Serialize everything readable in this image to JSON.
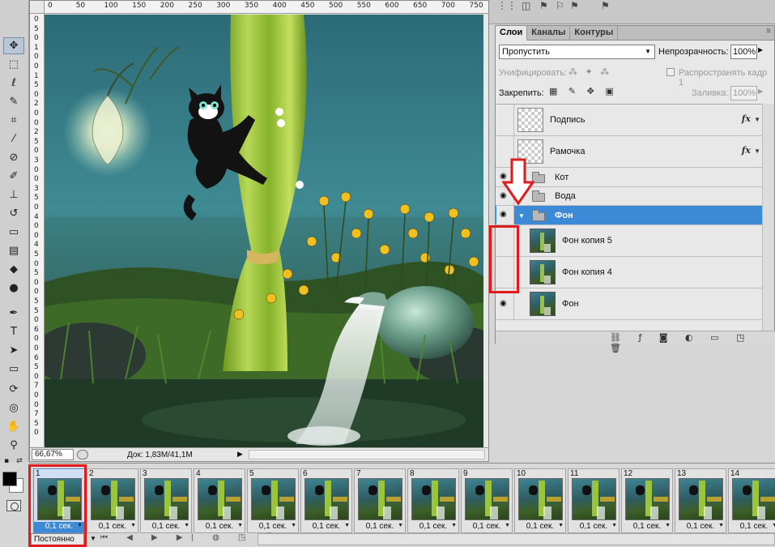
{
  "ruler": {
    "top_ticks": [
      "0",
      "50",
      "100",
      "150",
      "200",
      "250",
      "300",
      "350",
      "400",
      "450",
      "500",
      "550",
      "600",
      "650",
      "700",
      "750"
    ],
    "left_ticks": [
      "0",
      "5",
      "0",
      "1",
      "0",
      "0",
      "1",
      "5",
      "0",
      "2",
      "0",
      "0",
      "2",
      "5",
      "0",
      "3",
      "0",
      "0",
      "3",
      "5",
      "0",
      "4",
      "0",
      "0",
      "4",
      "5",
      "0",
      "5",
      "0",
      "0",
      "5",
      "5",
      "0",
      "6",
      "0",
      "0",
      "6",
      "5",
      "0",
      "7",
      "0",
      "0",
      "7",
      "5",
      "0"
    ]
  },
  "status": {
    "zoom": "66,67%",
    "doc_info": "Док: 1,83M/41,1M",
    "arrow": "▶"
  },
  "layers_panel": {
    "tabs": [
      "Слои",
      "Каналы",
      "Контуры"
    ],
    "blend_mode": "Пропустить",
    "opacity_label": "Непрозрачность:",
    "opacity_value": "100%",
    "unify_label": "Унифицировать:",
    "propagate_label": "Распространять кадр 1",
    "lock_label": "Закрепить:",
    "fill_label": "Заливка:",
    "fill_value": "100%",
    "layers": [
      {
        "name": "Подпись",
        "fx": "fx"
      },
      {
        "name": "Рамочка",
        "fx": "fx"
      },
      {
        "name": "Кот"
      },
      {
        "name": "Вода"
      },
      {
        "name": "Фон"
      },
      {
        "name": "Фон копия 5"
      },
      {
        "name": "Фон копия 4"
      },
      {
        "name": "Фон"
      }
    ]
  },
  "animation": {
    "frames": [
      {
        "num": "1",
        "delay": "0,1 сек."
      },
      {
        "num": "2",
        "delay": "0,1 сек."
      },
      {
        "num": "3",
        "delay": "0,1 сек."
      },
      {
        "num": "4",
        "delay": "0,1 сек."
      },
      {
        "num": "5",
        "delay": "0,1 сек."
      },
      {
        "num": "6",
        "delay": "0,1 сек."
      },
      {
        "num": "7",
        "delay": "0,1 сек."
      },
      {
        "num": "8",
        "delay": "0,1 сек."
      },
      {
        "num": "9",
        "delay": "0,1 сек."
      },
      {
        "num": "10",
        "delay": "0,1 сек."
      },
      {
        "num": "11",
        "delay": "0,1 сек."
      },
      {
        "num": "12",
        "delay": "0,1 сек."
      },
      {
        "num": "13",
        "delay": "0,1 сек."
      },
      {
        "num": "14",
        "delay": "0,1 сек."
      }
    ],
    "loop": "Постоянно"
  },
  "colors": {
    "highlight": "#e01b1b",
    "selection": "#3c8ad6"
  }
}
